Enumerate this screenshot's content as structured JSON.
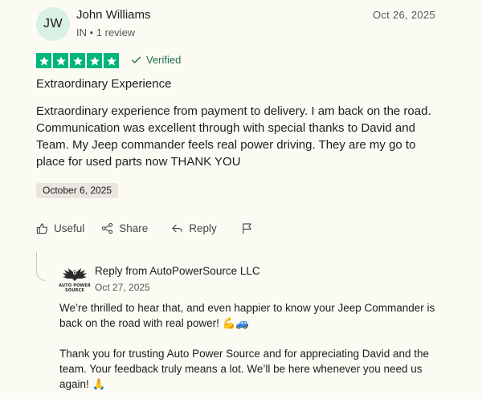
{
  "reviewer": {
    "initials": "JW",
    "name": "John Williams",
    "meta": "IN • 1 review",
    "review_date": "Oct 26, 2025"
  },
  "rating": {
    "stars": 5,
    "max": 5,
    "color": "#00b67a"
  },
  "verified_label": "Verified",
  "review": {
    "title": "Extraordinary Experience",
    "body": "Extraordinary experience from payment to delivery. I am back on the road. Communication was excellent through with special thanks to David and Team. My Jeep commander feels real power driving. They are my go to place for used parts now THANK YOU",
    "experience_date": "October 6, 2025"
  },
  "actions": {
    "useful": "Useful",
    "share": "Share",
    "reply": "Reply"
  },
  "company_reply": {
    "logo_text_line1": "AUTO POWER",
    "logo_text_line2": "SOURCE",
    "from": "Reply from AutoPowerSource LLC",
    "date": "Oct 27, 2025",
    "paragraph1": "We’re thrilled to hear that, and even happier to know your Jeep Commander is back on the road with real power! 💪🚙",
    "paragraph2": "Thank you for trusting Auto Power Source and for appreciating David and the team. Your feedback truly means a lot. We’ll be here whenever you need us again! 🙏"
  }
}
